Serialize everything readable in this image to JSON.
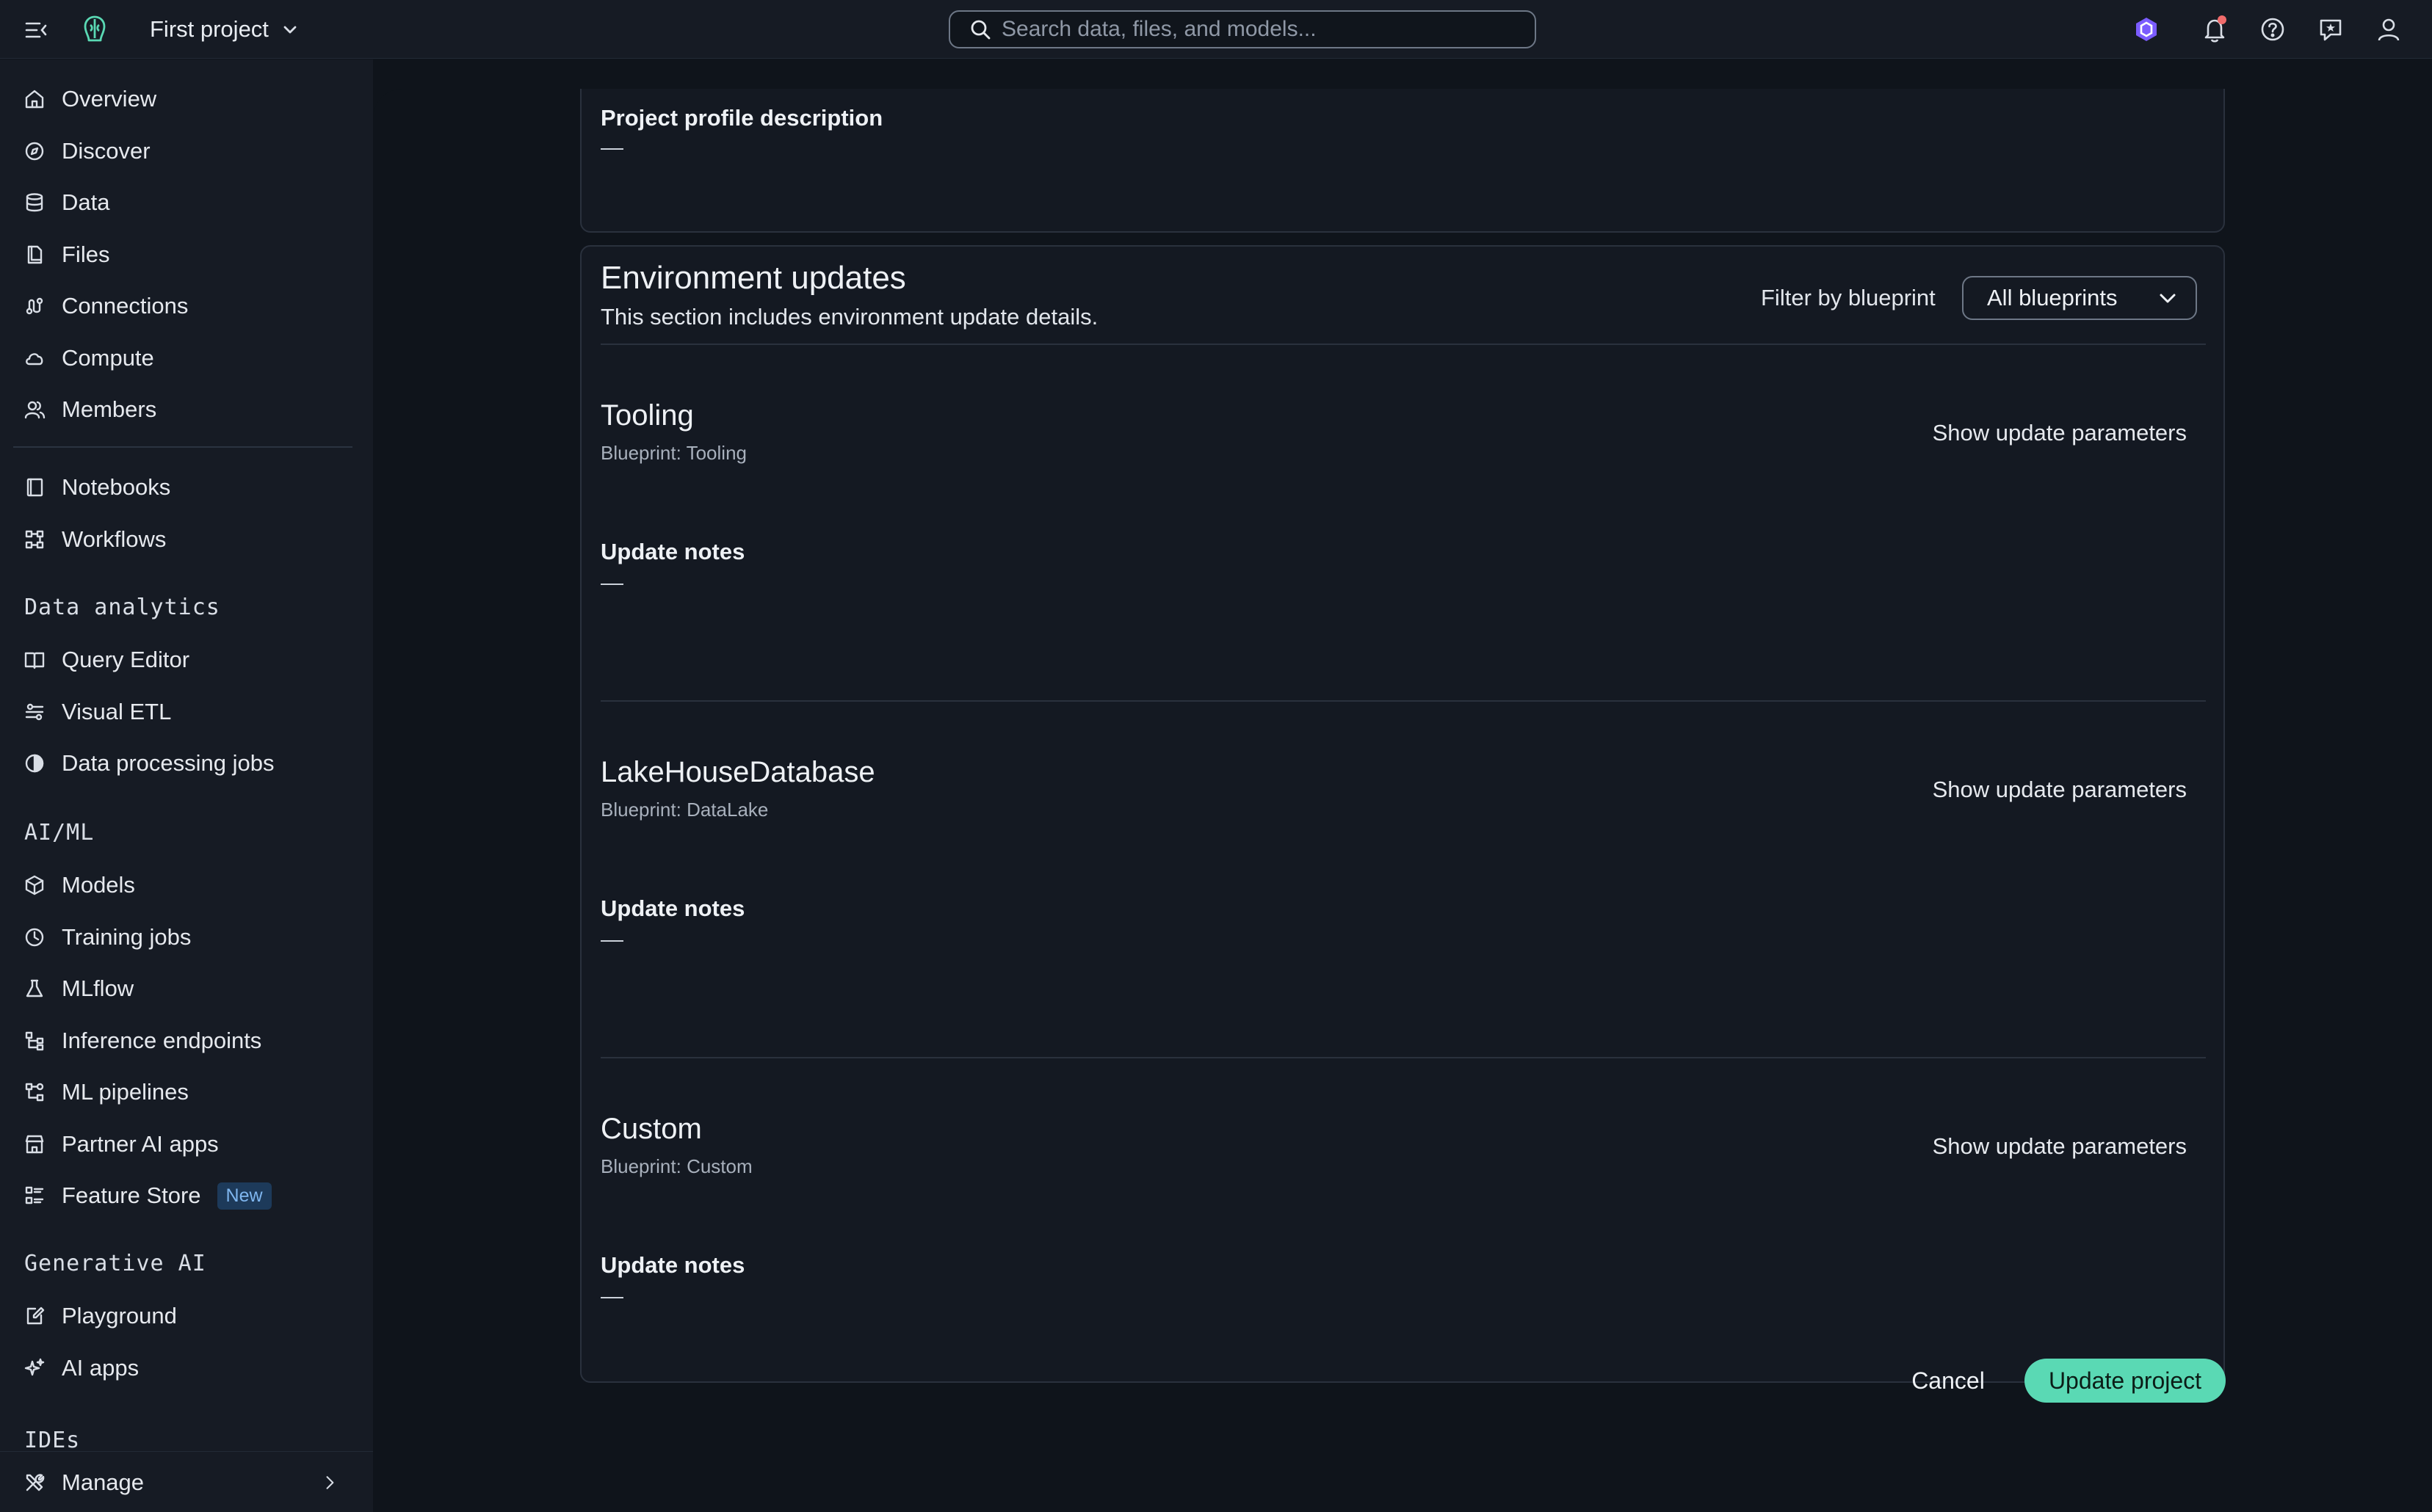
{
  "topbar": {
    "project_name": "First project",
    "search_placeholder": "Search data, files, and models...",
    "icons": [
      "menu-collapse-icon",
      "app-logo-icon",
      "chevron-down-icon",
      "search-icon",
      "amazon-q-icon",
      "bell-icon",
      "help-icon",
      "feedback-icon",
      "user-icon"
    ]
  },
  "sidebar": {
    "group1": [
      {
        "label": "Overview",
        "icon": "home-icon"
      },
      {
        "label": "Discover",
        "icon": "compass-icon"
      },
      {
        "label": "Data",
        "icon": "database-icon"
      },
      {
        "label": "Files",
        "icon": "file-icon"
      },
      {
        "label": "Connections",
        "icon": "connections-icon"
      },
      {
        "label": "Compute",
        "icon": "cloud-icon"
      },
      {
        "label": "Members",
        "icon": "members-icon"
      }
    ],
    "group2": [
      {
        "label": "Notebooks",
        "icon": "notebook-icon"
      },
      {
        "label": "Workflows",
        "icon": "workflow-icon"
      }
    ],
    "section_data_analytics": "Data analytics",
    "data_analytics": [
      {
        "label": "Query Editor",
        "icon": "book-icon"
      },
      {
        "label": "Visual ETL",
        "icon": "etl-icon"
      },
      {
        "label": "Data processing jobs",
        "icon": "processing-icon"
      }
    ],
    "section_aiml": "AI/ML",
    "aiml": [
      {
        "label": "Models",
        "icon": "cube-icon"
      },
      {
        "label": "Training jobs",
        "icon": "clock-icon"
      },
      {
        "label": "MLflow",
        "icon": "flask-icon"
      },
      {
        "label": "Inference endpoints",
        "icon": "endpoint-icon"
      },
      {
        "label": "ML pipelines",
        "icon": "pipeline-icon"
      },
      {
        "label": "Partner AI apps",
        "icon": "store-icon"
      },
      {
        "label": "Feature Store",
        "icon": "feature-store-icon",
        "badge": "New"
      }
    ],
    "section_genai": "Generative AI",
    "genai": [
      {
        "label": "Playground",
        "icon": "playground-icon"
      },
      {
        "label": "AI apps",
        "icon": "sparkle-icon"
      }
    ],
    "section_ides_partial": "IDEs",
    "manage_label": "Manage"
  },
  "profile": {
    "description_label": "Project profile description",
    "description_value": "—"
  },
  "env_updates": {
    "title": "Environment updates",
    "subtitle": "This section includes environment update details.",
    "filter_label": "Filter by blueprint",
    "filter_value": "All blueprints",
    "items": [
      {
        "name": "Tooling",
        "blueprint": "Blueprint: Tooling",
        "action": "Show update parameters",
        "notes_label": "Update notes",
        "notes_value": "—"
      },
      {
        "name": "LakeHouseDatabase",
        "blueprint": "Blueprint: DataLake",
        "action": "Show update parameters",
        "notes_label": "Update notes",
        "notes_value": "—"
      },
      {
        "name": "Custom",
        "blueprint": "Blueprint: Custom",
        "action": "Show update parameters",
        "notes_label": "Update notes",
        "notes_value": "—"
      }
    ]
  },
  "actions": {
    "cancel": "Cancel",
    "update": "Update project"
  },
  "colors": {
    "accent": "#5ad9b4",
    "badge_bg": "#1d3a5a",
    "badge_text": "#7fb6ef",
    "notification_dot": "#f06b6b",
    "amazon_q": "#7b5cff"
  }
}
